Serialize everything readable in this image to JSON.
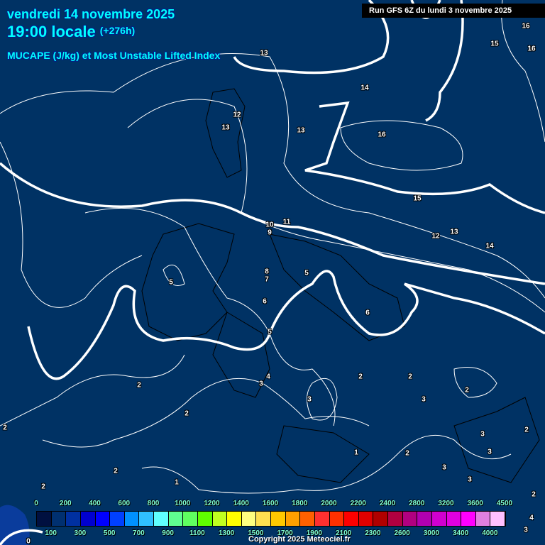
{
  "header": {
    "date": "vendredi 14 novembre 2025",
    "time": "19:00 locale",
    "lead": "(+276h)",
    "parameter": "MUCAPE (J/kg) et Most Unstable Lifted Index",
    "run": "Run GFS 6Z du lundi 3 novembre 2025"
  },
  "contour_labels": [
    "13",
    "12",
    "13",
    "13",
    "14",
    "16",
    "15",
    "16",
    "15",
    "16",
    "10",
    "11",
    "9",
    "12",
    "13",
    "14",
    "8",
    "7",
    "5",
    "5",
    "6",
    "6",
    "5",
    "4",
    "3",
    "2",
    "2",
    "2",
    "2",
    "3",
    "3",
    "2",
    "2",
    "3",
    "2",
    "1",
    "2",
    "3",
    "3",
    "2",
    "3",
    "1",
    "2",
    "2",
    "4",
    "3",
    "0"
  ],
  "legend": {
    "top_ticks": [
      "0",
      "200",
      "400",
      "600",
      "800",
      "1000",
      "1200",
      "1400",
      "1600",
      "1800",
      "2000",
      "2200",
      "2400",
      "2800",
      "3200",
      "3600",
      "4500"
    ],
    "bottom_ticks": [
      "100",
      "300",
      "500",
      "700",
      "900",
      "1100",
      "1300",
      "1500",
      "1700",
      "1900",
      "2100",
      "2300",
      "2600",
      "3000",
      "3400",
      "4000"
    ],
    "colors": [
      "#001040",
      "#003070",
      "#0030a0",
      "#0000d0",
      "#0000ff",
      "#0040ff",
      "#0090ff",
      "#30c0ff",
      "#60ffff",
      "#60ff90",
      "#60ff60",
      "#60ff00",
      "#c0ff20",
      "#ffff00",
      "#ffff80",
      "#ffe050",
      "#ffc800",
      "#ffa000",
      "#ff6000",
      "#ff3030",
      "#ff3000",
      "#ff0000",
      "#e00000",
      "#b00000",
      "#b00040",
      "#b00080",
      "#b000b0",
      "#d000d0",
      "#e000e0",
      "#ff00ff",
      "#e080e0",
      "#ffc0ff",
      "#ffffff"
    ]
  },
  "copyright": "Copyright 2025 Meteociel.fr",
  "colors": {
    "background": "#003264",
    "title": "#00ffff",
    "cape_low": "#0a3c9c"
  }
}
